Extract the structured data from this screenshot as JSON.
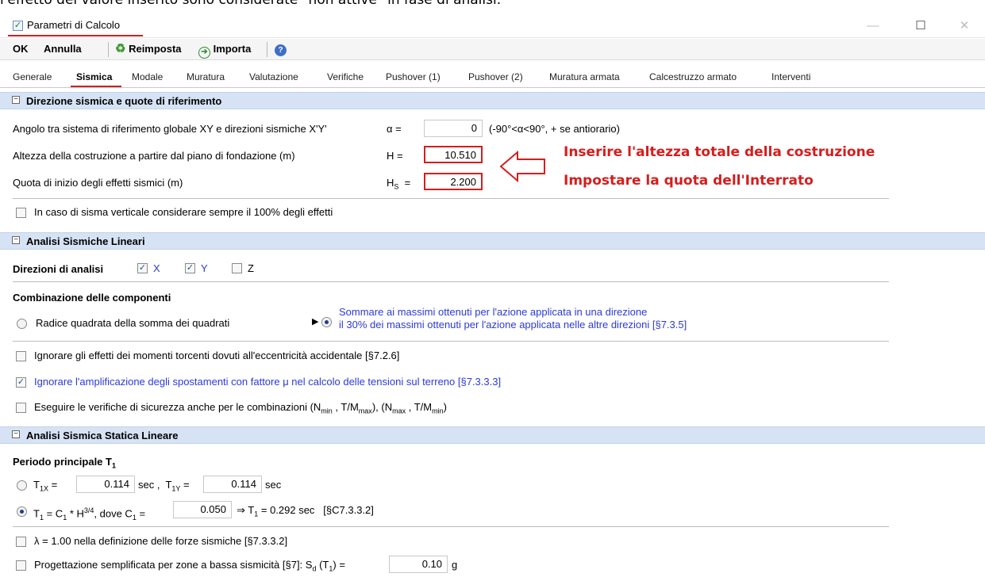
{
  "caption": "l'effetto del valore inserito sono considerate \"non attive\" in fase di analisi.",
  "window": {
    "title": "Parametri di Calcolo",
    "minimize": "—",
    "maximize": "☐",
    "close": "✕"
  },
  "toolbar": {
    "ok": "OK",
    "annulla": "Annulla",
    "reimposta": "Reimposta",
    "importa": "Importa"
  },
  "tabs": [
    "Generale",
    "Sismica",
    "Modale",
    "Muratura",
    "Valutazione",
    "Verifiche",
    "Pushover (1)",
    "Pushover (2)",
    "Muratura armata",
    "Calcestruzzo armato",
    "Interventi"
  ],
  "active_tab": "Sismica",
  "section1": {
    "title": "Direzione sismica e quote di riferimento",
    "angle_label": "Angolo tra sistema di riferimento globale XY e direzioni sismiche X'Y'",
    "angle_symbol": "α   =",
    "angle_value": "0",
    "angle_hint": "(-90°<α<90°, + se antiorario)",
    "height_label": "Altezza della costruzione a partire dal piano di fondazione (m)",
    "height_symbol": "H   =",
    "height_value": "10.510",
    "quota_label": "Quota di inizio degli effetti sismici (m)",
    "quota_symbol": "H",
    "quota_sub": "S",
    "quota_eq": "=",
    "quota_value": "2.200",
    "vertical_label": "In caso di sisma verticale considerare sempre il 100% degli effetti",
    "vertical_checked": false
  },
  "annotations": {
    "note1": "Inserire l'altezza totale della costruzione",
    "note2": "Impostare la quota dell'Interrato"
  },
  "section2": {
    "title": "Analisi Sismiche Lineari",
    "directions_label": "Direzioni di analisi",
    "dir_x": "X",
    "dir_y": "Y",
    "dir_z": "Z",
    "dir_x_checked": true,
    "dir_y_checked": true,
    "dir_z_checked": false,
    "combination_label": "Combinazione delle componenti",
    "srss_label": "Radice quadrata della somma dei quadrati",
    "sum_label_1": "Sommare ai massimi ottenuti per l'azione applicata in una direzione",
    "sum_label_2": "il 30% dei massimi ottenuti per l'azione applicata nelle altre direzioni [§7.3.5]",
    "ignore_torsion": "Ignorare gli effetti dei momenti torcenti dovuti all'eccentricità accidentale [§7.2.6]",
    "ignore_torsion_checked": false,
    "ignore_amplification": "Ignorare l'amplificazione degli spostamenti con fattore μ nel calcolo delle tensioni sul terreno [§7.3.3.3]",
    "ignore_amplification_checked": true,
    "safety_checks_prefix": "Eseguire le verifiche di sicurezza anche per le combinazioni (N",
    "safety_checked": false
  },
  "section3": {
    "title": "Analisi Sismica Statica Lineare",
    "period_label": "Periodo principale T",
    "period_sub": "1",
    "t1x_value": "0.114",
    "t1y_value": "0.114",
    "sec": "sec",
    "c1_value": "0.050",
    "t1_result": "⇒ T",
    "t1_result_value": "= 0.292 sec",
    "t1_ref": "[§C7.3.3.2]",
    "lambda_label": "λ = 1.00 nella definizione delle forze sismiche [§7.3.3.2]",
    "lambda_checked": false,
    "simplified_label": "Progettazione semplificata per zone a bassa sismicità [§7]: S",
    "simplified_value": "0.10",
    "simplified_unit": "g",
    "simplified_checked": false
  }
}
